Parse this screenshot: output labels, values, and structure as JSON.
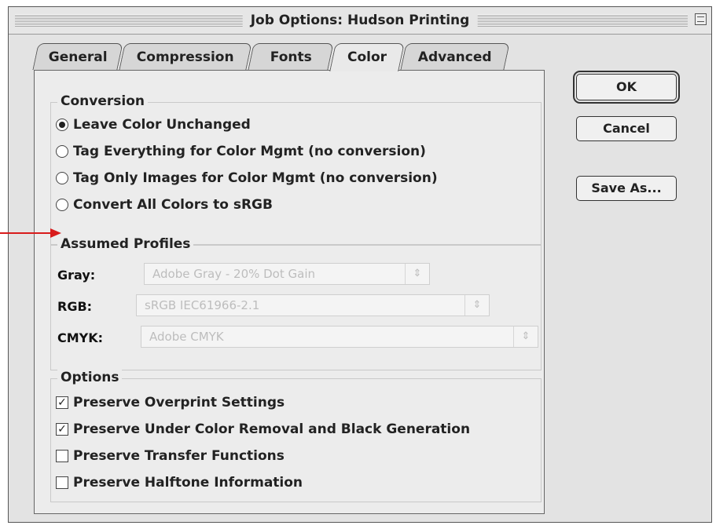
{
  "window": {
    "title": "Job Options: Hudson Printing"
  },
  "tabs": [
    {
      "label": "General"
    },
    {
      "label": "Compression"
    },
    {
      "label": "Fonts"
    },
    {
      "label": "Color",
      "active": true
    },
    {
      "label": "Advanced"
    }
  ],
  "conversion": {
    "title": "Conversion",
    "options": [
      {
        "label": "Leave Color Unchanged",
        "selected": true
      },
      {
        "label": "Tag Everything for Color Mgmt (no conversion)",
        "selected": false
      },
      {
        "label": "Tag Only Images for Color Mgmt (no conversion)",
        "selected": false
      },
      {
        "label": "Convert All Colors to sRGB",
        "selected": false
      }
    ]
  },
  "profiles": {
    "title": "Assumed Profiles",
    "gray": {
      "label": "Gray:",
      "value": "Adobe Gray - 20% Dot Gain"
    },
    "rgb": {
      "label": "RGB:",
      "value": "sRGB IEC61966-2.1"
    },
    "cmyk": {
      "label": "CMYK:",
      "value": "Adobe CMYK"
    }
  },
  "options": {
    "title": "Options",
    "items": [
      {
        "label": "Preserve Overprint Settings",
        "checked": true
      },
      {
        "label": "Preserve Under Color Removal and Black Generation",
        "checked": true
      },
      {
        "label": "Preserve Transfer Functions",
        "checked": false
      },
      {
        "label": "Preserve Halftone Information",
        "checked": false
      }
    ]
  },
  "buttons": {
    "ok": "OK",
    "cancel": "Cancel",
    "save_as": "Save As..."
  },
  "icons": {
    "zoom": "zoom-box-icon",
    "popup_arrows": "up-down-arrows-icon",
    "callout": "red-arrow-icon",
    "checkmark": "☑"
  },
  "colors": {
    "callout": "#d81b1b"
  }
}
